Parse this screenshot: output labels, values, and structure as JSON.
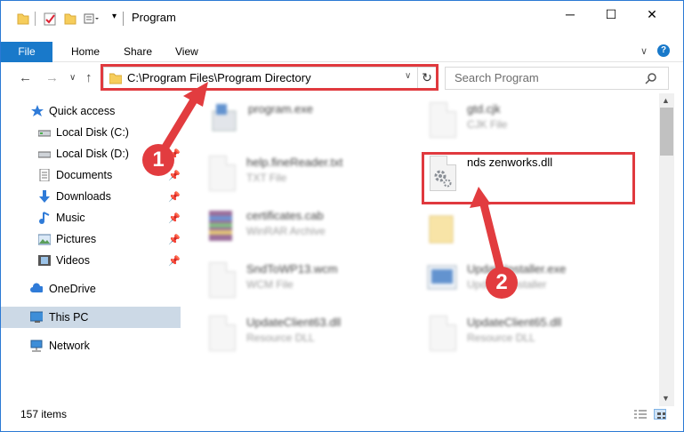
{
  "window": {
    "title": "Program",
    "controls": {
      "minimize": "─",
      "maximize": "☐",
      "close": "✕"
    }
  },
  "ribbon": {
    "tabs": [
      "File",
      "Home",
      "Share",
      "View"
    ],
    "help": "?",
    "collapse": "∨"
  },
  "nav": {
    "back": "←",
    "forward": "→",
    "recent": "∨",
    "up": "↑",
    "address": "C:\\Program Files\\Program Directory",
    "address_dropdown": "∨",
    "refresh": "↻",
    "search_placeholder": "Search Program"
  },
  "sidebar": {
    "items": [
      {
        "label": "Quick access",
        "icon": "star-icon"
      },
      {
        "label": "Local Disk (C:)",
        "icon": "drive-icon"
      },
      {
        "label": "Local Disk (D:)",
        "icon": "drive-icon",
        "pin": "📌"
      },
      {
        "label": "Documents",
        "icon": "documents-icon",
        "pin": "📌"
      },
      {
        "label": "Downloads",
        "icon": "download-icon",
        "pin": "📌"
      },
      {
        "label": "Music",
        "icon": "music-icon",
        "pin": "📌"
      },
      {
        "label": "Pictures",
        "icon": "pictures-icon",
        "pin": "📌"
      },
      {
        "label": "Videos",
        "icon": "videos-icon",
        "pin": "📌"
      },
      {
        "label": "OneDrive",
        "icon": "cloud-icon"
      },
      {
        "label": "This PC",
        "icon": "monitor-icon",
        "selected": true
      },
      {
        "label": "Network",
        "icon": "network-icon"
      }
    ]
  },
  "files": [
    {
      "name": "program.exe",
      "type": ""
    },
    {
      "name": "gtd.cjk",
      "type": "CJK File"
    },
    {
      "name": "help.fineReader.txt",
      "type": "TXT File"
    },
    {
      "name": "nds zenworks.dll",
      "type": ""
    },
    {
      "name": "certificates.cab",
      "type": "WinRAR Archive"
    },
    {
      "name": "SndToWP13.wcm",
      "type": "WCM File"
    },
    {
      "name": "UpdateInstaller.exe",
      "type": "Updates installer"
    },
    {
      "name": "UpdateClient63.dll",
      "type": "Resource DLL"
    },
    {
      "name": "UpdateClient65.dll",
      "type": "Resource DLL"
    }
  ],
  "status": {
    "count": "157 items"
  },
  "annotations": {
    "callout_1": "1",
    "callout_2": "2"
  },
  "colors": {
    "accent": "#1979ca",
    "highlight": "#e0393e",
    "selected": "#ccd9e6"
  }
}
